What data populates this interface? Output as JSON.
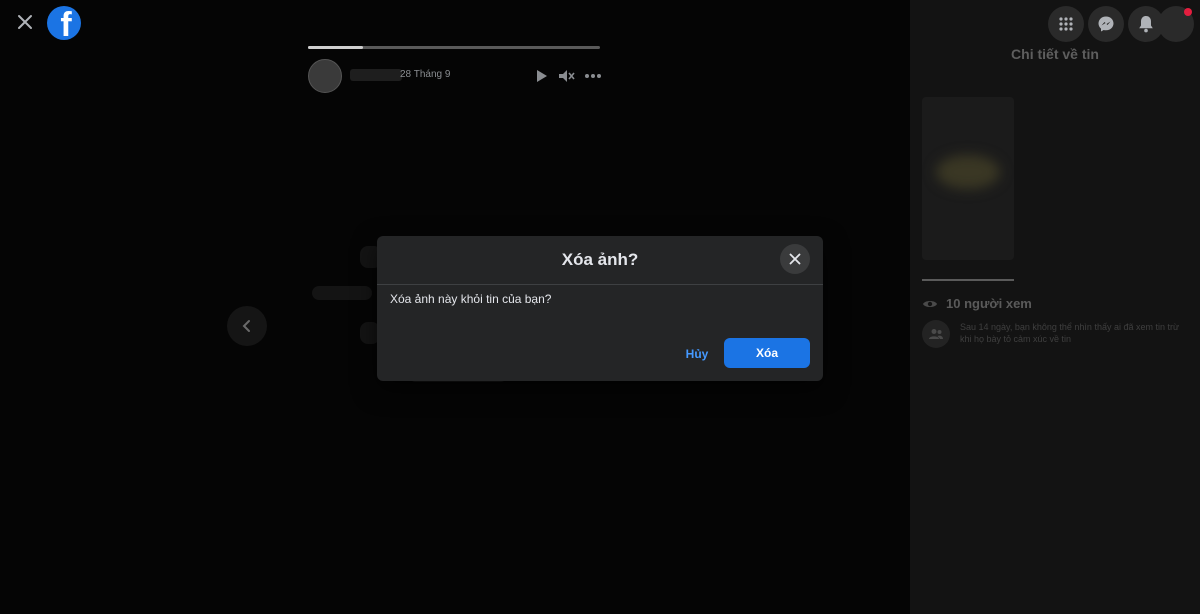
{
  "viewer": {
    "story_date": "28 Tháng 9",
    "progress": 0.19
  },
  "sidebar": {
    "title": "Chi tiết về tin",
    "viewers_label": "10 người xem",
    "info_text": "Sau 14 ngày, bạn không thể nhìn thấy ai đã xem tin trừ khi họ bày tỏ cảm xúc về tin"
  },
  "dialog": {
    "title": "Xóa ảnh?",
    "message": "Xóa ảnh này khỏi tin của bạn?",
    "cancel_label": "Hủy",
    "delete_label": "Xóa"
  },
  "colors": {
    "accent": "#1b74e4",
    "link": "#4599ff",
    "dialog_bg": "#242526",
    "notification": "#e41e3f"
  },
  "icons": {
    "close": "close-icon",
    "logo": "facebook-logo",
    "play": "play-icon",
    "mute": "mute-icon",
    "more": "more-icon",
    "prev": "chevron-left-icon",
    "menu": "grid-menu-icon",
    "messenger": "messenger-icon",
    "bell": "bell-icon",
    "eye": "eye-icon",
    "people": "people-icon"
  }
}
